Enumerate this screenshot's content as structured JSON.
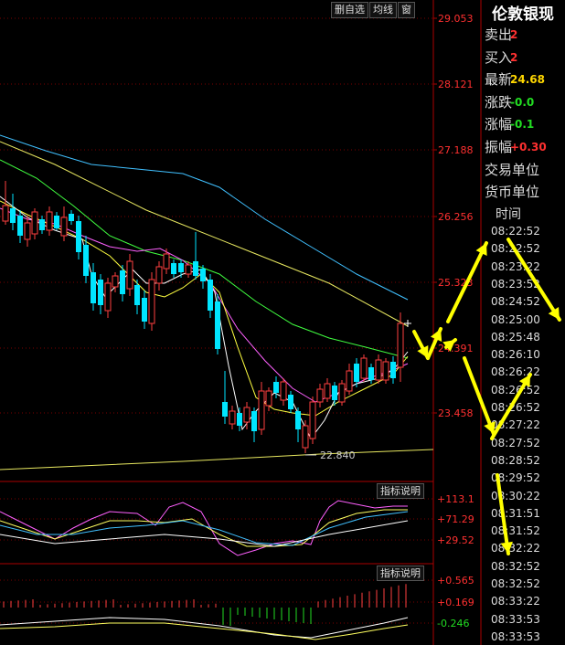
{
  "toolbar": {
    "delete_watch_label": "删自选",
    "ma_label": "均线",
    "window_label": "窗"
  },
  "price_axis_labels": [
    "29.053",
    "28.121",
    "27.188",
    "26.256",
    "25.323",
    "24.391",
    "23.458"
  ],
  "low_marker_label": "22.840",
  "indicator_panel_1": {
    "button_label": "指标说明",
    "axis_labels": [
      "+113.1",
      "+71.29",
      "+29.52"
    ]
  },
  "indicator_panel_2": {
    "button_label": "指标说明",
    "axis_labels": [
      "+0.565",
      "+0.169",
      "-0.246"
    ]
  },
  "quote_panel": {
    "title": "伦敦银现",
    "rows": [
      {
        "label": "卖出",
        "value": "2",
        "color": "#ff3030"
      },
      {
        "label": "买入",
        "value": "2",
        "color": "#ff3030"
      },
      {
        "label": "最新",
        "value": "24.68",
        "color": "#ffd700"
      },
      {
        "label": "涨跌",
        "value": "-0.0",
        "color": "#22dd22"
      },
      {
        "label": "涨幅",
        "value": "-0.1",
        "color": "#22dd22"
      },
      {
        "label": "振幅",
        "value": "+0.30",
        "color": "#ff3030"
      }
    ],
    "trade_unit_label": "交易单位",
    "currency_unit_label": "货币单位",
    "time_header": "时间",
    "times": [
      "08:22:52",
      "08:22:52",
      "08:23:22",
      "08:23:52",
      "08:24:52",
      "08:25:00",
      "08:25:48",
      "08:26:10",
      "08:26:22",
      "08:26:52",
      "08:26:52",
      "08:27:22",
      "08:27:52",
      "08:28:52",
      "08:29:52",
      "08:30:22",
      "08:31:51",
      "08:31:52",
      "08:32:22",
      "08:32:52",
      "08:32:52",
      "08:33:22",
      "08:33:53",
      "08:33:53"
    ]
  },
  "colors": {
    "up": "#ff4040",
    "down": "#00e5ff",
    "grid_red": "#7a0000",
    "ma_white": "#ffffff",
    "ma_yellow": "#ffff40",
    "ma_magenta": "#ff60ff",
    "ma_green": "#40ff40",
    "ma_cyan": "#40c0ff",
    "trend_yellow": "#e8e860",
    "arrow_yellow": "#ffff00"
  },
  "icons": [
    "candlestick-chart",
    "arrow-annotation"
  ]
}
